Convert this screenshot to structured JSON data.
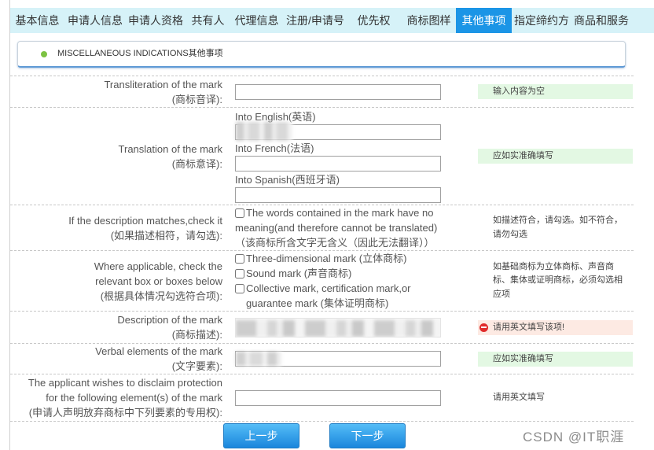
{
  "tabs": [
    {
      "label": "基本信息",
      "active": false
    },
    {
      "label": "申请人信息",
      "active": false
    },
    {
      "label": "申请人资格",
      "active": false
    },
    {
      "label": "共有人",
      "active": false
    },
    {
      "label": "代理信息",
      "active": false
    },
    {
      "label": "注册/申请号",
      "active": false
    },
    {
      "label": "优先权",
      "active": false
    },
    {
      "label": "商标图样",
      "active": false
    },
    {
      "label": "其他事项",
      "active": true
    },
    {
      "label": "指定缔约方",
      "active": false
    },
    {
      "label": "商品和服务",
      "active": false
    }
  ],
  "section": {
    "title": "MISCELLANEOUS INDICATIONS其他事项",
    "bullet_icon": "green-dot-icon",
    "bullet_color": "#7cc242"
  },
  "form": {
    "transliteration": {
      "label": [
        "Transliteration of the mark",
        "(商标音译):"
      ],
      "value": "",
      "hint": "输入内容为空",
      "hint_bg": "#e3f8e3"
    },
    "translation": {
      "label": [
        "Translation of the mark",
        "(商标意译):"
      ],
      "english": {
        "label": "Into English(英语)"
      },
      "french": {
        "label": "Into French(法语)",
        "value": ""
      },
      "spanish": {
        "label": "Into Spanish(西班牙语)",
        "value": ""
      },
      "hint": "应如实准确填写",
      "hint_bg": "#e3f8e3"
    },
    "no_meaning": {
      "label": [
        "If the description matches,check it",
        "(如果描述相符，请勾选):"
      ],
      "option": {
        "lines": [
          "The words contained in the mark have no",
          "meaning(and therefore cannot be translated)",
          "（该商标所含文字无含义（因此无法翻译））"
        ],
        "checked": false
      },
      "hint": [
        "如描述符合，请勾选。如不符合，",
        "请勿勾选"
      ]
    },
    "mark_type": {
      "label": [
        "Where applicable, check the",
        "relevant box or boxes below",
        "(根据具体情况勾选符合项):"
      ],
      "options": [
        {
          "lines": [
            "Three-dimensional mark (立体商标)"
          ],
          "checked": false
        },
        {
          "lines": [
            "Sound mark (声音商标)"
          ],
          "checked": false
        },
        {
          "lines": [
            "Collective mark, certification mark,or",
            "guarantee mark (集体证明商标)"
          ],
          "checked": false
        }
      ],
      "hint": [
        "如基础商标为立体商标、声音商",
        "标、集体或证明商标，必须勾选相",
        "应项"
      ]
    },
    "description": {
      "label": [
        "Description of the mark",
        "(商标描述):"
      ],
      "hint": "请用英文填写该项!",
      "hint_icon": "minus-circle-icon",
      "hint_icon_color": "#e02b2b",
      "hint_bg": "#fdeae3"
    },
    "verbal_elements": {
      "label": [
        "Verbal elements of the mark",
        "(文字要素):"
      ],
      "hint": "应如实准确填写",
      "hint_bg": "#e3f8e3"
    },
    "disclaimer": {
      "label": [
        "The applicant wishes to disclaim protection",
        "for the following element(s) of the mark",
        "(申请人声明放弃商标中下列要素的专用权):"
      ],
      "value": "",
      "hint": "请用英文填写"
    }
  },
  "buttons": {
    "prev": "上一步",
    "next": "下一步"
  },
  "watermark": "CSDN @IT职涯",
  "colors": {
    "tab_bar_bg": "#d6f2f8",
    "active_tab_bg": "#1b95e6",
    "button_bg": "#2a93e2"
  }
}
